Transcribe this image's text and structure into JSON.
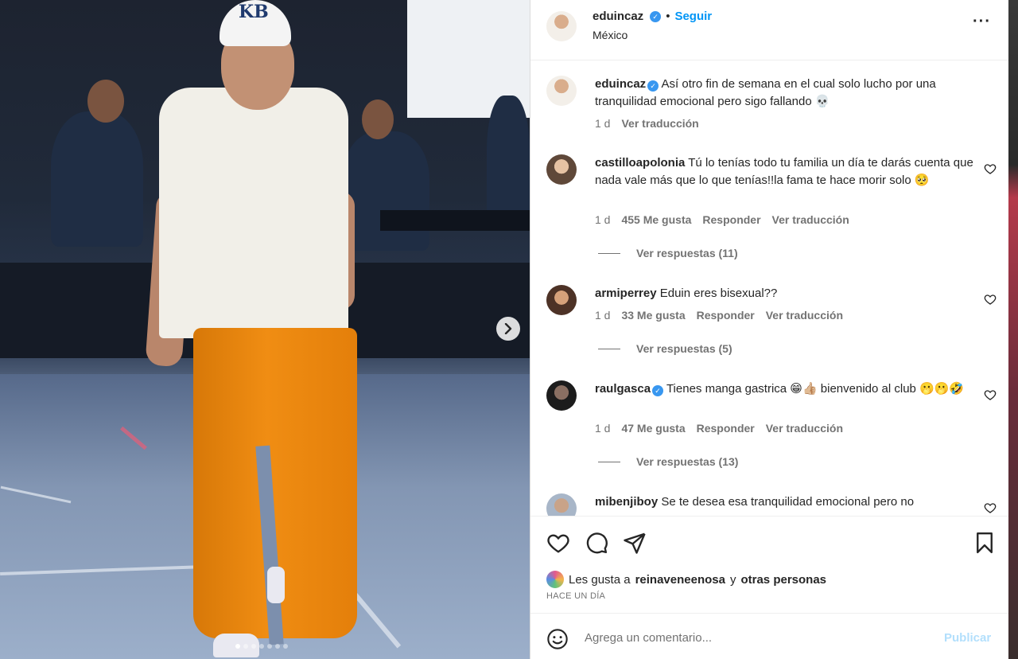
{
  "post": {
    "username": "eduincaz",
    "follow_label": "Seguir",
    "separator": "•",
    "location": "México",
    "more_icon": "more-options-icon",
    "photo_carousel": {
      "total": 7,
      "active_index": 0
    }
  },
  "caption": {
    "username": "eduincaz",
    "text": "Así otro fin de semana en el cual solo lucho por una tranquilidad emocional pero sigo fallando 💀",
    "time": "1 d",
    "translate": "Ver traducción"
  },
  "comments": [
    {
      "username": "castilloapolonia",
      "text": "Tú lo tenías todo tu familia un día te darás cuenta que nada vale más que lo que tenías!!la fama te hace morir solo 🥺",
      "time": "1 d",
      "likes": "455 Me gusta",
      "reply": "Responder",
      "translate": "Ver traducción",
      "replies": "Ver respuestas (11)"
    },
    {
      "username": "armiperrey",
      "text": "Eduin eres bisexual??",
      "time": "1 d",
      "likes": "33 Me gusta",
      "reply": "Responder",
      "translate": "Ver traducción",
      "replies": "Ver respuestas (5)"
    },
    {
      "username": "raulgasca",
      "text": "Tienes manga gastrica 😁👍🏼 bienvenido al club 🫢🫢🤣",
      "time": "1 d",
      "likes": "47 Me gusta",
      "reply": "Responder",
      "translate": "Ver traducción",
      "replies": "Ver respuestas (13)"
    },
    {
      "username": "mibenjiboy",
      "text": "Se te desea esa tranquilidad emocional pero no"
    }
  ],
  "likes_summary": {
    "prefix": "Les gusta a",
    "user": "reinaveneenosa",
    "connector": "y",
    "others": "otras personas"
  },
  "time_ago": "HACE UN DÍA",
  "compose": {
    "placeholder": "Agrega un comentario...",
    "publish_label": "Publicar"
  },
  "colors": {
    "accent": "#0095f6",
    "verified": "#3897f0",
    "muted_text": "#737373",
    "publish_disabled": "#b2dffc"
  }
}
